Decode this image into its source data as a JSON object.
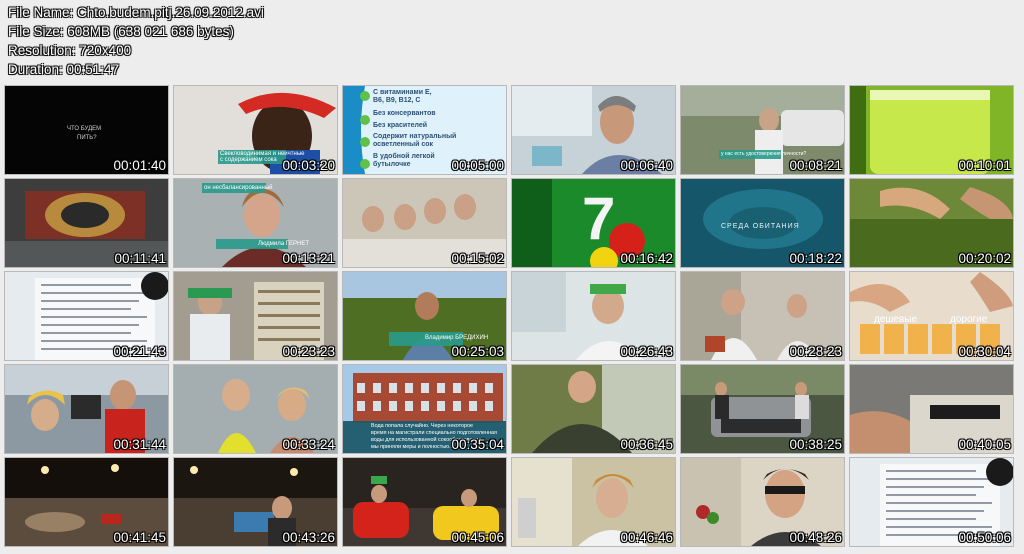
{
  "header": {
    "file_name": "File Name: Chto.budem.pitj.26.09.2012.avi",
    "file_size": "File Size: 608MB (638 021 686 bytes)",
    "resolution": "Resolution: 720x400",
    "duration": "Duration: 00:51:47"
  },
  "thumbnails": [
    {
      "ts": "00:01:40",
      "bg": "#060606",
      "art": "title"
    },
    {
      "ts": "00:03:20",
      "bg": "#e4e2de",
      "art": "face-red"
    },
    {
      "ts": "00:05:00",
      "bg": "#2aa6cf",
      "art": "label"
    },
    {
      "ts": "00:06:40",
      "bg": "#bcc9d1",
      "art": "lab-man"
    },
    {
      "ts": "00:08:21",
      "bg": "#6a7256",
      "art": "outdoor"
    },
    {
      "ts": "00:10:01",
      "bg": "#5f9e1c",
      "art": "juice"
    },
    {
      "ts": "00:11:41",
      "bg": "#3d3f3e",
      "art": "sign"
    },
    {
      "ts": "00:13:21",
      "bg": "#a8afb1",
      "art": "woman"
    },
    {
      "ts": "00:15:02",
      "bg": "#c8c2b2",
      "art": "women"
    },
    {
      "ts": "00:16:42",
      "bg": "#1e8d2a",
      "art": "sevenup"
    },
    {
      "ts": "00:18:22",
      "bg": "#1f6b7e",
      "art": "water"
    },
    {
      "ts": "00:20:02",
      "bg": "#4f6d28",
      "art": "hands"
    },
    {
      "ts": "00:21:43",
      "bg": "#dfe5ea",
      "art": "doc"
    },
    {
      "ts": "00:23:23",
      "bg": "#a19e92",
      "art": "factory"
    },
    {
      "ts": "00:25:03",
      "bg": "#58772e",
      "art": "orchard"
    },
    {
      "ts": "00:26:43",
      "bg": "#d9e0e2",
      "art": "lab-woman"
    },
    {
      "ts": "00:28:23",
      "bg": "#c9c4b8",
      "art": "lab-two"
    },
    {
      "ts": "00:30:04",
      "bg": "#e5d9c9",
      "art": "glasses"
    },
    {
      "ts": "00:31:44",
      "bg": "#8e9aa4",
      "art": "fair"
    },
    {
      "ts": "00:33:24",
      "bg": "#9da7a9",
      "art": "drink"
    },
    {
      "ts": "00:35:04",
      "bg": "#a5553f",
      "art": "building"
    },
    {
      "ts": "00:36:45",
      "bg": "#5f6a3b",
      "art": "guard"
    },
    {
      "ts": "00:38:25",
      "bg": "#4e5843",
      "art": "car"
    },
    {
      "ts": "00:40:05",
      "bg": "#7b7a78",
      "art": "machine"
    },
    {
      "ts": "00:41:45",
      "bg": "#141110",
      "art": "arena"
    },
    {
      "ts": "00:43:26",
      "bg": "#201a16",
      "art": "arena2"
    },
    {
      "ts": "00:45:06",
      "bg": "#2a2522",
      "art": "bumper"
    },
    {
      "ts": "00:46:46",
      "bg": "#c8bf9e",
      "art": "boy"
    },
    {
      "ts": "00:48:26",
      "bg": "#d9d2c2",
      "art": "glasses-man"
    },
    {
      "ts": "00:50:06",
      "bg": "#e1e6ea",
      "art": "doc"
    }
  ],
  "overlays": {
    "t1": [
      "ЧТО БУДЕМ",
      "ПИТЬ?"
    ],
    "t2": [
      "Свекловодинимая и неичтные",
      "с содержанием сока"
    ],
    "t3": [
      "С витаминами Е,",
      "В6, В9, В12, С",
      "Без консервантов",
      "Без красителей",
      "Содержит натуральный",
      "осветленный сок",
      "В удобной легкой",
      "бутылочке"
    ],
    "t5": "у нас есть удостоверения личности?",
    "t8a": "он несбалансированный",
    "t8b": "Людмила ГЕРНЕТ",
    "t11": "СРЕДА  ОБИТАНИЯ",
    "t15": "Владимир БРЕДИХИН",
    "t18": [
      "дешевые",
      "дорогие"
    ],
    "t21": [
      "Вода попала случайно. Через  некоторое",
      "время на магистрали специально подготовленная",
      "воды для использованной сокообразования",
      "мы приняли меры и полностью..."
    ]
  }
}
